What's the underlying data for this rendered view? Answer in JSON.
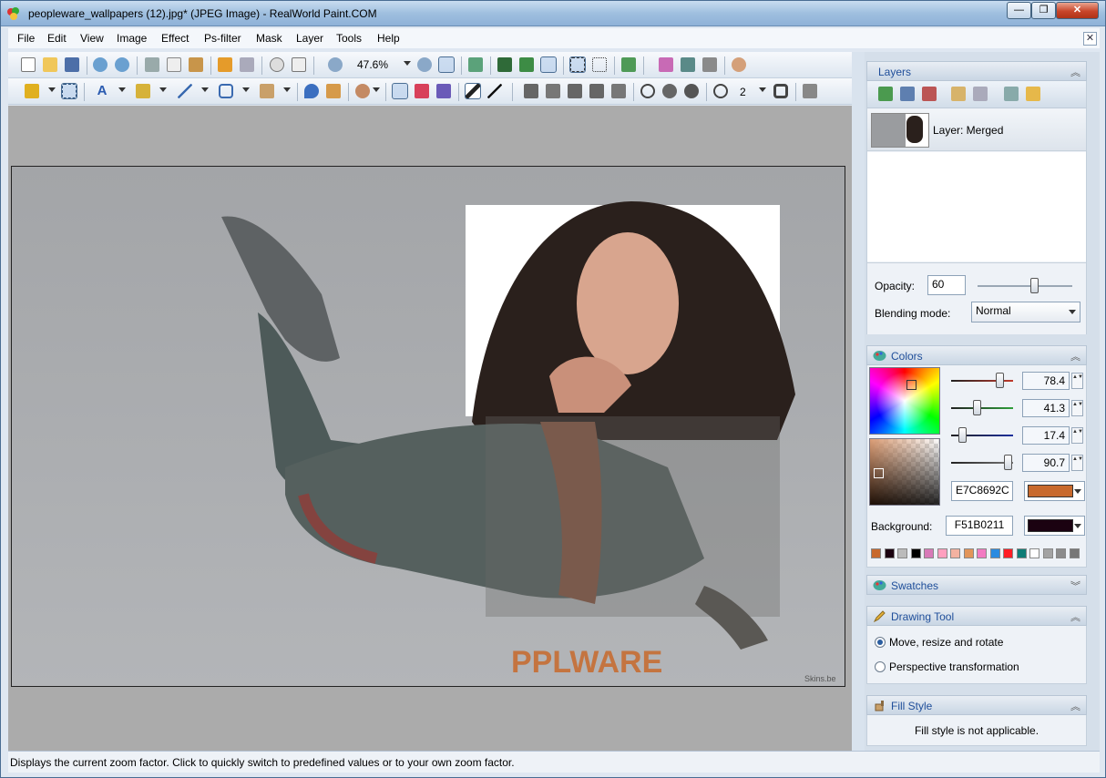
{
  "window": {
    "title": "peopleware_wallpapers (12).jpg* (JPEG Image) - RealWorld Paint.COM",
    "minimize": "—",
    "maximize": "❐",
    "close": "✕"
  },
  "menu": [
    "File",
    "Edit",
    "View",
    "Image",
    "Effect",
    "Ps-filter",
    "Mask",
    "Layer",
    "Tools",
    "Help"
  ],
  "mdi_close": "✕",
  "toolbar": {
    "zoom": "47.6%",
    "brush_size": "2"
  },
  "image": {
    "watermark_text": "PPLWARE",
    "corner_credit": "Skins.be"
  },
  "layers": {
    "title": "Layers",
    "items": [
      {
        "name": "Layer: Merged"
      }
    ],
    "opacity_label": "Opacity:",
    "opacity_value": "60",
    "opacity_percent": 60,
    "blend_label": "Blending mode:",
    "blend_value": "Normal"
  },
  "colors": {
    "title": "Colors",
    "channels": [
      {
        "value": "78.4",
        "color": "#c0392b"
      },
      {
        "value": "41.3",
        "color": "#2e9e3a"
      },
      {
        "value": "17.4",
        "color": "#1d2f9c"
      },
      {
        "value": "90.7",
        "color": "#777777"
      }
    ],
    "foreground_hex": "E7C8692C",
    "foreground_color": "#c8692c",
    "background_label": "Background:",
    "background_hex": "F51B0211",
    "background_color": "#1b0211",
    "palette": [
      "#c8692c",
      "#1b0211",
      "#bbbbbb",
      "#000000",
      "#d87ab8",
      "#ff9fbf",
      "#f3b2a1",
      "#e2955a",
      "#f27bc2",
      "#2b8be0",
      "#ff1d25",
      "#0e7d77",
      "#ffffff",
      "#a3a3a3",
      "#8c8c8c",
      "#777777"
    ]
  },
  "swatches": {
    "title": "Swatches"
  },
  "drawing_tool": {
    "title": "Drawing Tool",
    "options": [
      {
        "label": "Move, resize and rotate",
        "selected": true
      },
      {
        "label": "Perspective transformation",
        "selected": false
      }
    ]
  },
  "fill_style": {
    "title": "Fill Style",
    "message": "Fill style is not applicable."
  },
  "status": "Displays the current zoom factor. Click to quickly switch to predefined values or to your own zoom factor."
}
